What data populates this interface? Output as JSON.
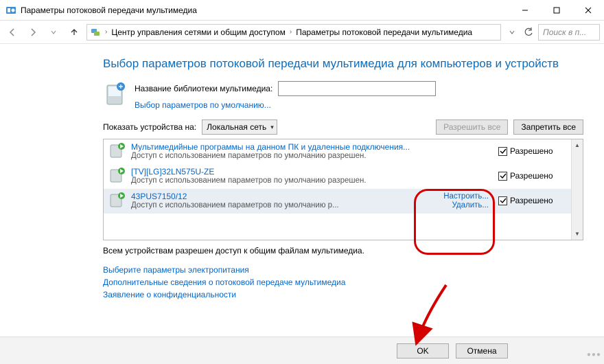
{
  "window": {
    "title": "Параметры потоковой передачи мультимедиа"
  },
  "breadcrumb": {
    "part1": "Центр управления сетями и общим доступом",
    "part2": "Параметры потоковой передачи мультимедиа"
  },
  "search": {
    "placeholder": "Поиск в п..."
  },
  "heading": "Выбор параметров потоковой передачи мультимедиа для компьютеров и устройств",
  "library": {
    "label": "Название библиотеки мультимедиа:",
    "value": "",
    "defaults_link": "Выбор параметров по умолчанию..."
  },
  "show_on": {
    "label": "Показать устройства на:",
    "value": "Локальная сеть"
  },
  "buttons": {
    "allow_all": "Разрешить все",
    "block_all": "Запретить все",
    "ok": "OK",
    "cancel": "Отмена"
  },
  "devices": [
    {
      "title": "Мультимедийные программы на данном ПК и удаленные подключения...",
      "subtitle": "Доступ с использованием параметров по умолчанию разрешен.",
      "allowed_label": "Разрешено",
      "checked": true
    },
    {
      "title": "[TV][LG]32LN575U-ZE",
      "subtitle": "Доступ с использованием параметров по умолчанию разрешен.",
      "allowed_label": "Разрешено",
      "checked": true
    },
    {
      "title": "43PUS7150/12",
      "subtitle": "Доступ с использованием параметров по умолчанию р...",
      "allowed_label": "Разрешено",
      "checked": true,
      "configure": "Настроить...",
      "remove": "Удалить..."
    }
  ],
  "status_line": "Всем устройствам разрешен доступ к общим файлам мультимедиа.",
  "links": {
    "power": "Выберите параметры электропитания",
    "more": "Дополнительные сведения о потоковой передаче мультимедиа",
    "privacy": "Заявление о конфиденциальности"
  }
}
